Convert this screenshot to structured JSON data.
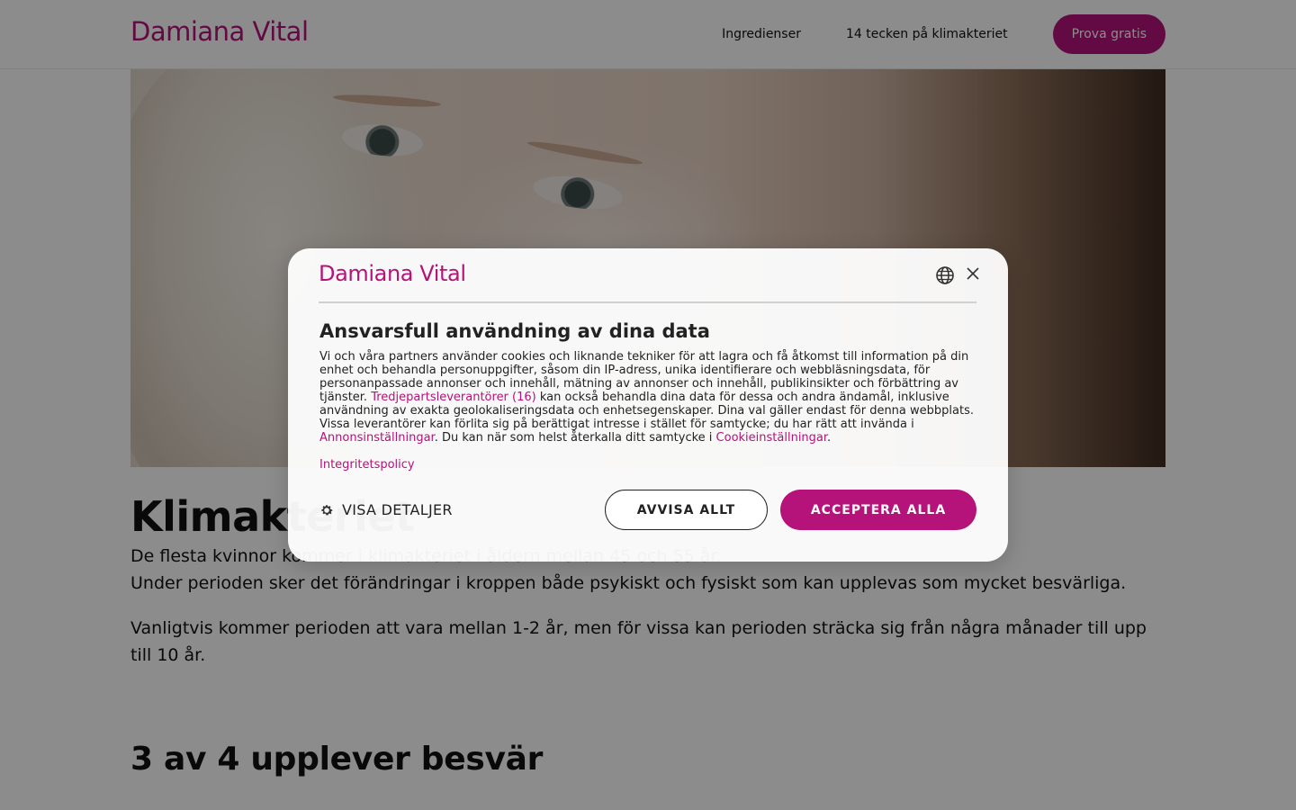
{
  "header": {
    "logo": "Damiana Vital",
    "nav": [
      {
        "label": "Ingredienser"
      },
      {
        "label": "14 tecken på klimakteriet"
      }
    ],
    "cta_label": "Prova gratis"
  },
  "hero": {
    "image": "woman-face-photo"
  },
  "article": {
    "title": "Klimakteriet",
    "p1_line1": "De flesta kvinnor kommer i klimakteriet i åldern mellan 45 och 55 år.",
    "p1_line2": "Under perioden sker det förändringar i kroppen både psykiskt och fysiskt som kan upplevas som mycket besvärliga.",
    "p2": "Vanligtvis kommer perioden att vara mellan 1-2 år, men för vissa kan perioden sträcka sig från några månader till upp till 10 år.",
    "h2": "3 av 4 upplever besvär"
  },
  "consent": {
    "logo": "Damiana Vital",
    "title": "Ansvarsfull användning av dina data",
    "body_part1": "Vi och våra partners använder cookies och liknande tekniker för att lagra och få åtkomst till information på din enhet och behandla personuppgifter, såsom din IP-adress, unika identifierare och webbläsningsdata, för personanpassade annonser och innehåll, mätning av annonser och innehåll, publikinsikter och förbättring av tjänster.",
    "link_vendors": "Tredjepartsleverantörer (16)",
    "body_part2": "kan också behandla dina data för dessa och andra ändamål, inklusive användning av exakta geolokaliseringsdata och enhetsegenskaper. Dina val gäller endast för denna webbplats. Vissa leverantörer kan förlita sig på berättigat intresse i stället för samtycke; du har rätt att invända i",
    "link_ads": "Annonsinställningar",
    "body_part3": ". Du kan när som helst återkalla ditt samtycke i",
    "link_cookies": "Cookieinställningar",
    "body_part4": ".",
    "policy_label": "Integritetspolicy",
    "details_label": "VISA DETALJER",
    "reject_label": "AVVISA ALLT",
    "accept_label": "ACCEPTERA ALLA"
  },
  "colors": {
    "brand": "#b5127a",
    "overlay": "rgba(0,0,0,0.45)"
  }
}
